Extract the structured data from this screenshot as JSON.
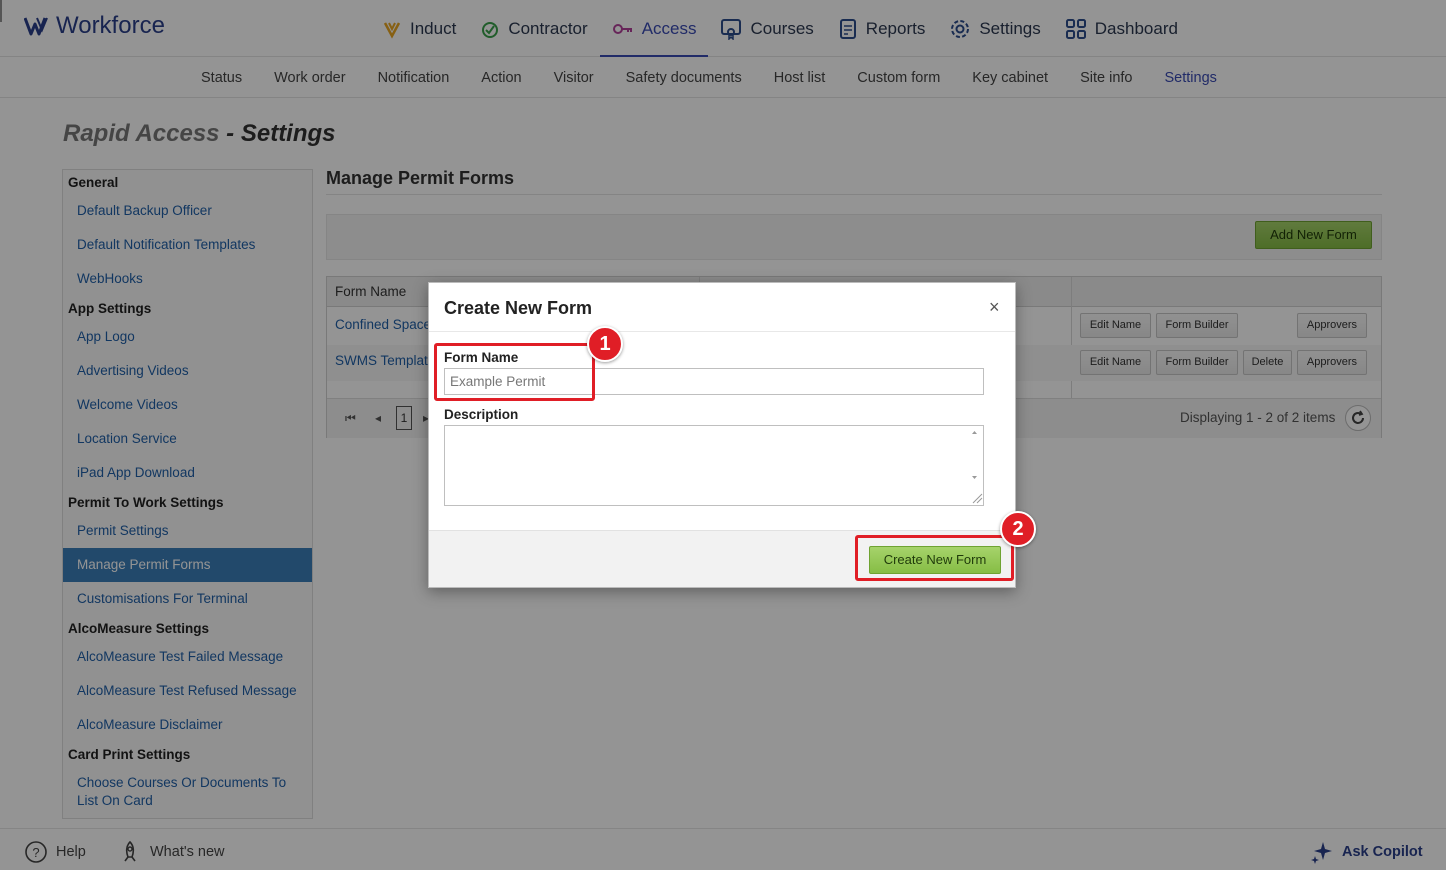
{
  "app": {
    "name": "Workforce"
  },
  "main_nav": [
    {
      "label": "Induct",
      "icon": "induct-icon",
      "active": false
    },
    {
      "label": "Contractor",
      "icon": "contractor-icon",
      "active": false
    },
    {
      "label": "Access",
      "icon": "key-icon",
      "active": true
    },
    {
      "label": "Courses",
      "icon": "courses-icon",
      "active": false
    },
    {
      "label": "Reports",
      "icon": "reports-icon",
      "active": false
    },
    {
      "label": "Settings",
      "icon": "gear-icon",
      "active": false
    },
    {
      "label": "Dashboard",
      "icon": "dashboard-icon",
      "active": false
    }
  ],
  "sub_nav": [
    "Status",
    "Work order",
    "Notification",
    "Action",
    "Visitor",
    "Safety documents",
    "Host list",
    "Custom form",
    "Key cabinet",
    "Site info",
    "Settings"
  ],
  "sub_nav_active": "Settings",
  "page": {
    "title_prefix": "Rapid Access",
    "title_suffix": " - Settings"
  },
  "sidebar": {
    "sections": [
      {
        "header": "General",
        "items": [
          "Default Backup Officer",
          "Default Notification Templates",
          "WebHooks"
        ]
      },
      {
        "header": "App Settings",
        "items": [
          "App Logo",
          "Advertising Videos",
          "Welcome Videos",
          "Location Service",
          "iPad App Download"
        ]
      },
      {
        "header": "Permit To Work Settings",
        "items": [
          "Permit Settings",
          "Manage Permit Forms",
          "Customisations For Terminal"
        ]
      },
      {
        "header": "AlcoMeasure Settings",
        "items": [
          "AlcoMeasure Test Failed Message",
          "AlcoMeasure Test Refused Message",
          "AlcoMeasure Disclaimer"
        ]
      },
      {
        "header": "Card Print Settings",
        "items": [
          "Choose Courses Or Documents To",
          "List On Card"
        ]
      }
    ],
    "selected": "Manage Permit Forms"
  },
  "content": {
    "title": "Manage Permit Forms",
    "add_button": "Add New Form",
    "grid": {
      "column_header": "Form Name",
      "rows": [
        {
          "name": "Confined Space",
          "actions": [
            "Edit Name",
            "Form Builder",
            "Approvers"
          ]
        },
        {
          "name": "SWMS Template",
          "actions": [
            "Edit Name",
            "Form Builder",
            "Delete",
            "Approvers"
          ]
        }
      ],
      "current_page": "1",
      "pager_info": "Displaying 1 - 2 of 2 items"
    }
  },
  "footer": {
    "help": "Help",
    "whats_new": "What's new",
    "copilot": "Ask Copilot"
  },
  "modal": {
    "title": "Create New Form",
    "close": "×",
    "form_name_label": "Form Name",
    "form_name_placeholder": "Example Permit",
    "description_label": "Description",
    "submit": "Create New Form"
  },
  "annotations": {
    "badge_1": "1",
    "badge_2": "2"
  },
  "colors": {
    "brand": "#2a3f8a",
    "accent": "#3a4bb3",
    "highlight": "#e01e26",
    "green_button": "#86bd45",
    "selected_item": "#3c7fb8"
  }
}
